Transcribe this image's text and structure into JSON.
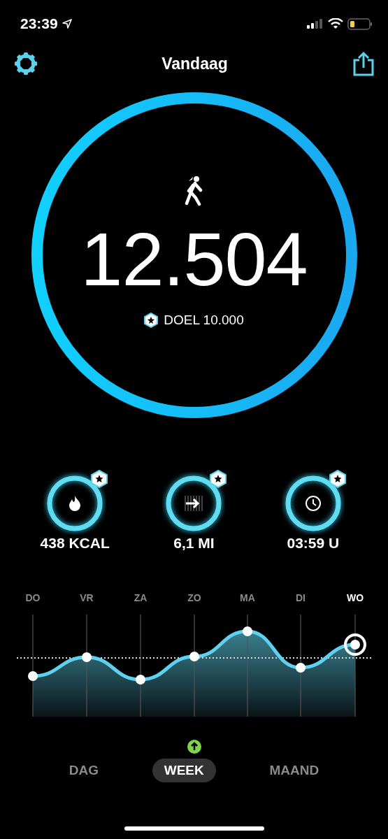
{
  "status_bar": {
    "time": "23:39"
  },
  "header": {
    "title": "Vandaag"
  },
  "steps": {
    "value": "12.504",
    "goal": "DOEL 10.000",
    "level": 1
  },
  "stats": [
    {
      "kind": "calories",
      "value": "438 KCAL",
      "level": 1
    },
    {
      "kind": "distance",
      "value": "6,1 MI",
      "level": 1
    },
    {
      "kind": "time",
      "value": "03:59 U",
      "level": 1
    }
  ],
  "days": [
    {
      "label": "DO",
      "selected": false
    },
    {
      "label": "VR",
      "selected": false
    },
    {
      "label": "ZA",
      "selected": false
    },
    {
      "label": "ZO",
      "selected": false
    },
    {
      "label": "MA",
      "selected": false
    },
    {
      "label": "DI",
      "selected": false
    },
    {
      "label": "WO",
      "selected": true
    }
  ],
  "periods": [
    {
      "label": "DAG",
      "selected": false
    },
    {
      "label": "WEEK",
      "selected": true
    },
    {
      "label": "MAAND",
      "selected": false
    }
  ]
}
